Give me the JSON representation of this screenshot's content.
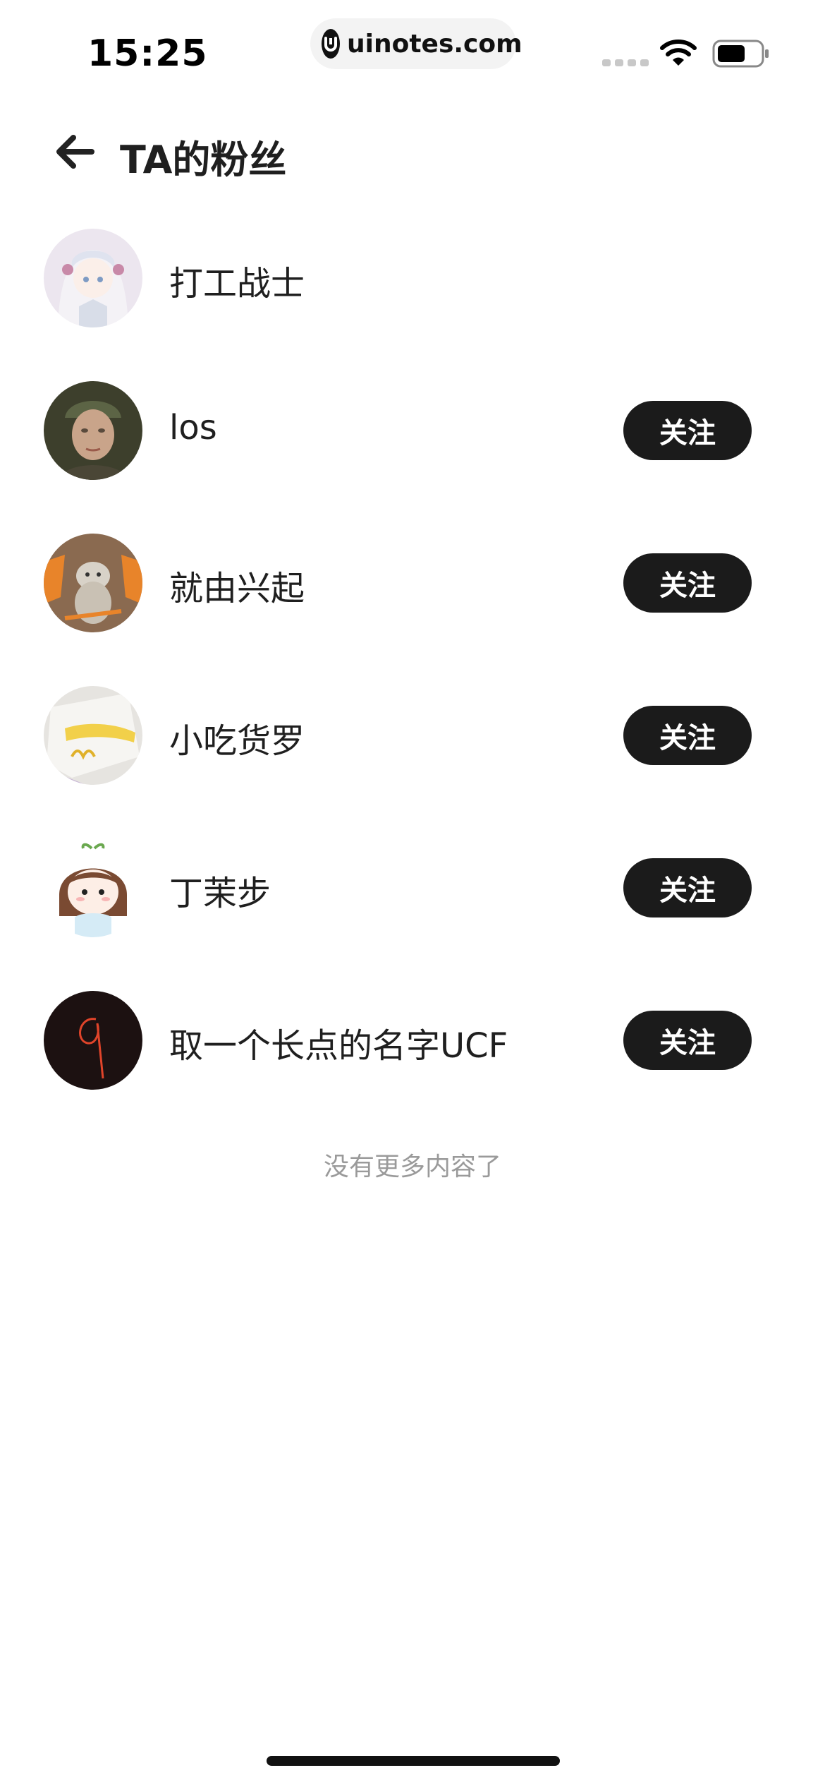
{
  "status_bar": {
    "time": "15:25",
    "url": "uinotes.com",
    "icons": [
      "signal-icon",
      "wifi-icon",
      "battery-icon"
    ]
  },
  "header": {
    "back_icon": "arrow-left-icon",
    "title": "TA的粉丝"
  },
  "fans": [
    {
      "name": "打工战士",
      "show_follow": false,
      "follow_label": ""
    },
    {
      "name": "los",
      "show_follow": true,
      "follow_label": "关注"
    },
    {
      "name": "就由兴起",
      "show_follow": true,
      "follow_label": "关注"
    },
    {
      "name": "小吃货罗",
      "show_follow": true,
      "follow_label": "关注"
    },
    {
      "name": "丁茉步",
      "show_follow": true,
      "follow_label": "关注"
    },
    {
      "name": "取一个长点的名字UCF",
      "show_follow": true,
      "follow_label": "关注"
    }
  ],
  "footer": {
    "end_text": "没有更多内容了"
  },
  "colors": {
    "button_bg": "#1b1b1b",
    "button_text": "#ffffff",
    "muted_text": "#9a9a9a"
  }
}
